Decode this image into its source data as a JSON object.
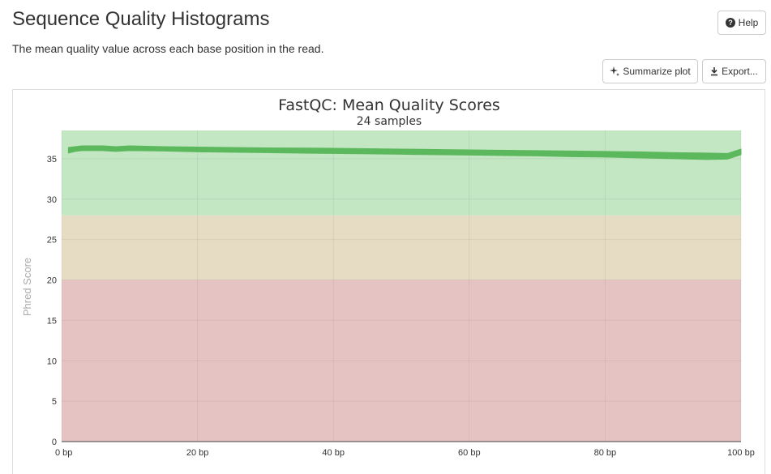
{
  "header": {
    "title": "Sequence Quality Histograms",
    "description": "The mean quality value across each base position in the read."
  },
  "buttons": {
    "help_label": "Help",
    "summarize_label": "Summarize plot",
    "export_label": "Export..."
  },
  "icons": {
    "help": "question-circle-icon",
    "summarize": "sparkle-icon",
    "export": "download-icon"
  },
  "colors": {
    "good_zone": "#c3e6c3",
    "warn_zone": "#e6dcc3",
    "fail_zone": "#e6c3c3",
    "line": "#5cb85c"
  },
  "chart_data": {
    "type": "line",
    "title": "FastQC: Mean Quality Scores",
    "subtitle": "24 samples",
    "xlabel": "",
    "ylabel": "Phred Score",
    "xlim": [
      0,
      100
    ],
    "ylim": [
      0,
      38.5
    ],
    "x_ticks": [
      0,
      20,
      40,
      60,
      80,
      100
    ],
    "x_tick_labels": [
      "0 bp",
      "20 bp",
      "40 bp",
      "60 bp",
      "80 bp",
      "100 bp"
    ],
    "y_ticks": [
      0,
      5,
      10,
      15,
      20,
      25,
      30,
      35
    ],
    "y_tick_labels": [
      "0",
      "5",
      "10",
      "15",
      "20",
      "25",
      "30",
      "35"
    ],
    "grid": true,
    "zones": [
      {
        "name": "fail",
        "from": 0,
        "to": 20,
        "color": "#e6c3c3"
      },
      {
        "name": "warn",
        "from": 20,
        "to": 28,
        "color": "#e6dcc3"
      },
      {
        "name": "pass",
        "from": 28,
        "to": 38.5,
        "color": "#c3e6c3"
      }
    ],
    "series": [
      {
        "upper": [
          [
            1,
            36.4
          ],
          [
            2,
            36.5
          ],
          [
            3,
            36.6
          ],
          [
            4,
            36.6
          ],
          [
            6,
            36.6
          ],
          [
            8,
            36.5
          ],
          [
            10,
            36.6
          ],
          [
            15,
            36.5
          ],
          [
            20,
            36.45
          ],
          [
            30,
            36.35
          ],
          [
            40,
            36.3
          ],
          [
            50,
            36.2
          ],
          [
            60,
            36.1
          ],
          [
            70,
            36.0
          ],
          [
            75,
            35.95
          ],
          [
            80,
            35.9
          ],
          [
            85,
            35.85
          ],
          [
            90,
            35.75
          ],
          [
            95,
            35.7
          ],
          [
            98,
            35.65
          ],
          [
            100,
            36.2
          ]
        ],
        "lower": [
          [
            1,
            35.7
          ],
          [
            2,
            35.9
          ],
          [
            3,
            36.0
          ],
          [
            4,
            36.0
          ],
          [
            6,
            36.0
          ],
          [
            8,
            35.9
          ],
          [
            10,
            36.0
          ],
          [
            15,
            35.95
          ],
          [
            20,
            35.85
          ],
          [
            30,
            35.75
          ],
          [
            40,
            35.65
          ],
          [
            50,
            35.55
          ],
          [
            60,
            35.45
          ],
          [
            70,
            35.35
          ],
          [
            75,
            35.25
          ],
          [
            80,
            35.2
          ],
          [
            85,
            35.1
          ],
          [
            90,
            35.0
          ],
          [
            95,
            34.9
          ],
          [
            98,
            34.95
          ],
          [
            100,
            35.5
          ]
        ]
      }
    ]
  }
}
